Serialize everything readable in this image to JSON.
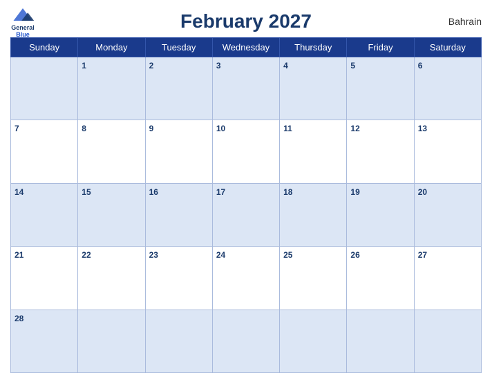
{
  "header": {
    "title": "February 2027",
    "country": "Bahrain",
    "logo": {
      "line1": "General",
      "line2": "Blue"
    }
  },
  "weekdays": [
    "Sunday",
    "Monday",
    "Tuesday",
    "Wednesday",
    "Thursday",
    "Friday",
    "Saturday"
  ],
  "weeks": [
    [
      null,
      1,
      2,
      3,
      4,
      5,
      6
    ],
    [
      7,
      8,
      9,
      10,
      11,
      12,
      13
    ],
    [
      14,
      15,
      16,
      17,
      18,
      19,
      20
    ],
    [
      21,
      22,
      23,
      24,
      25,
      26,
      27
    ],
    [
      28,
      null,
      null,
      null,
      null,
      null,
      null
    ]
  ]
}
